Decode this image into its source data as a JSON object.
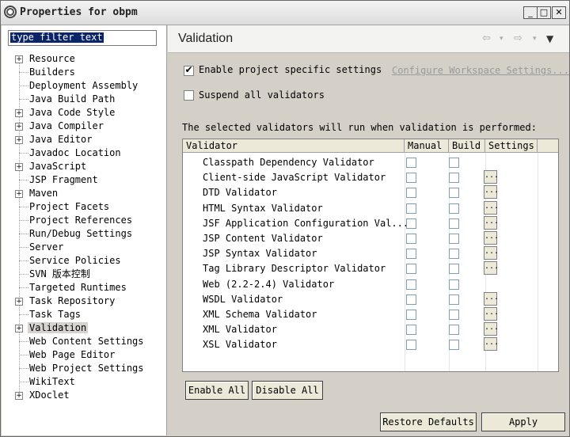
{
  "window": {
    "title": "Properties for obpm",
    "minimize": "_",
    "maximize": "□",
    "close": "✕"
  },
  "filter": {
    "value": "type filter text"
  },
  "tree": [
    {
      "label": "Resource",
      "expand": true
    },
    {
      "label": "Builders",
      "expand": false
    },
    {
      "label": "Deployment Assembly",
      "expand": false
    },
    {
      "label": "Java Build Path",
      "expand": false
    },
    {
      "label": "Java Code Style",
      "expand": true
    },
    {
      "label": "Java Compiler",
      "expand": true
    },
    {
      "label": "Java Editor",
      "expand": true
    },
    {
      "label": "Javadoc Location",
      "expand": false
    },
    {
      "label": "JavaScript",
      "expand": true
    },
    {
      "label": "JSP Fragment",
      "expand": false
    },
    {
      "label": "Maven",
      "expand": true
    },
    {
      "label": "Project Facets",
      "expand": false
    },
    {
      "label": "Project References",
      "expand": false
    },
    {
      "label": "Run/Debug Settings",
      "expand": false
    },
    {
      "label": "Server",
      "expand": false
    },
    {
      "label": "Service Policies",
      "expand": false
    },
    {
      "label": "SVN 版本控制",
      "expand": false
    },
    {
      "label": "Targeted Runtimes",
      "expand": false
    },
    {
      "label": "Task Repository",
      "expand": true
    },
    {
      "label": "Task Tags",
      "expand": false
    },
    {
      "label": "Validation",
      "expand": true,
      "selected": true
    },
    {
      "label": "Web Content Settings",
      "expand": false
    },
    {
      "label": "Web Page Editor",
      "expand": false
    },
    {
      "label": "Web Project Settings",
      "expand": false
    },
    {
      "label": "WikiText",
      "expand": false
    },
    {
      "label": "XDoclet",
      "expand": true
    }
  ],
  "page": {
    "title": "Validation",
    "enable_project_label": "Enable project specific settings",
    "enable_project_checked": true,
    "configure_link": "Configure Workspace Settings...",
    "suspend_label": "Suspend all validators",
    "suspend_checked": false,
    "info": "The selected validators will run when validation is performed:"
  },
  "table": {
    "headers": [
      "Validator",
      "Manual",
      "Build",
      "Settings"
    ],
    "rows": [
      {
        "name": "Classpath Dependency Validator",
        "settings": false
      },
      {
        "name": "Client-side JavaScript Validator",
        "settings": true
      },
      {
        "name": "DTD Validator",
        "settings": true
      },
      {
        "name": "HTML Syntax Validator",
        "settings": true
      },
      {
        "name": "JSF Application Configuration Val...",
        "settings": true
      },
      {
        "name": "JSP Content Validator",
        "settings": true
      },
      {
        "name": "JSP Syntax Validator",
        "settings": true
      },
      {
        "name": "Tag Library Descriptor Validator",
        "settings": true
      },
      {
        "name": "Web (2.2-2.4) Validator",
        "settings": false
      },
      {
        "name": "WSDL Validator",
        "settings": true
      },
      {
        "name": "XML Schema Validator",
        "settings": true
      },
      {
        "name": "XML Validator",
        "settings": true
      },
      {
        "name": "XSL Validator",
        "settings": true
      }
    ],
    "settings_glyph": "..."
  },
  "buttons": {
    "enable_all": "Enable All",
    "disable_all": "Disable All",
    "restore_defaults": "Restore Defaults",
    "apply": "Apply"
  }
}
